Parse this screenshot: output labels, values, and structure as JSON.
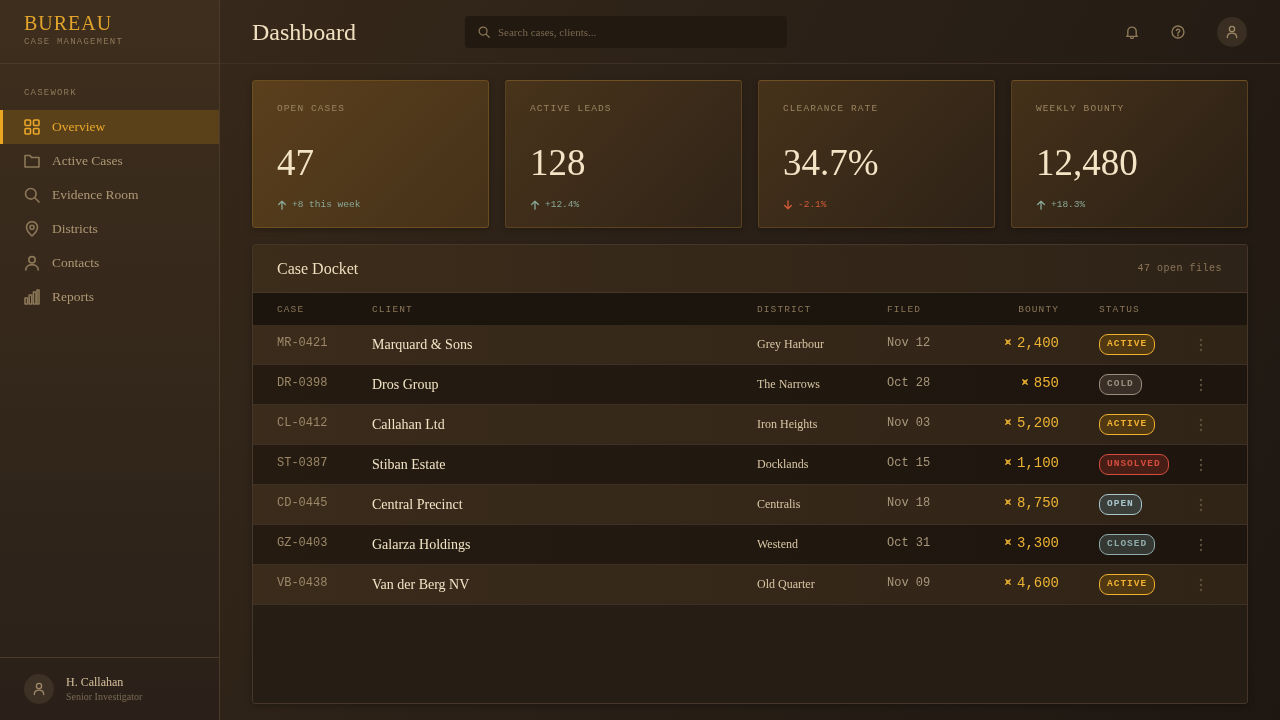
{
  "brand": {
    "title": "BUREAU",
    "subtitle": "CASE MANAGEMENT"
  },
  "sidebar": {
    "section": "CASEWORK",
    "items": [
      {
        "label": "Overview",
        "selected": true
      },
      {
        "label": "Active Cases",
        "selected": false
      },
      {
        "label": "Evidence Room",
        "selected": false
      },
      {
        "label": "Districts",
        "selected": false
      },
      {
        "label": "Contacts",
        "selected": false
      },
      {
        "label": "Reports",
        "selected": false
      }
    ],
    "user": {
      "name": "H. Callahan",
      "role": "Senior Investigator"
    }
  },
  "header": {
    "title": "Dashboard",
    "search": {
      "placeholder": "Search cases, clients..."
    }
  },
  "stats": [
    {
      "label": "OPEN CASES",
      "value": "47",
      "delta": "+8 this week",
      "kind": "up"
    },
    {
      "label": "ACTIVE LEADS",
      "value": "128",
      "delta": "+12.4%",
      "kind": "up"
    },
    {
      "label": "CLEARANCE RATE",
      "value": "34.7%",
      "delta": "-2.1%",
      "kind": "down"
    },
    {
      "label": "WEEKLY BOUNTY",
      "value": "12,480",
      "delta": "+18.3%",
      "kind": "up"
    }
  ],
  "docket": {
    "title": "Case Docket",
    "count": "47 open files",
    "columns": [
      "CASE",
      "CLIENT",
      "DISTRICT",
      "FILED",
      "BOUNTY",
      "STATUS"
    ],
    "rows": [
      {
        "case": "MR-0421",
        "client": "Marquard & Sons",
        "district": "Grey Harbour",
        "filed": "Nov 12",
        "bounty": "2,400",
        "status": {
          "label": "ACTIVE",
          "color": "#f0b030"
        }
      },
      {
        "case": "DR-0398",
        "client": "Dros Group",
        "district": "The Narrows",
        "filed": "Oct 28",
        "bounty": "850",
        "status": {
          "label": "COLD",
          "color": "#9c8e7e"
        }
      },
      {
        "case": "CL-0412",
        "client": "Callahan Ltd",
        "district": "Iron Heights",
        "filed": "Nov 03",
        "bounty": "5,200",
        "status": {
          "label": "ACTIVE",
          "color": "#f0b030"
        }
      },
      {
        "case": "ST-0387",
        "client": "Stiban Estate",
        "district": "Docklands",
        "filed": "Oct 15",
        "bounty": "1,100",
        "status": {
          "label": "UNSOLVED",
          "color": "#d44c3e"
        }
      },
      {
        "case": "CD-0445",
        "client": "Central Precinct",
        "district": "Centralis",
        "filed": "Nov 18",
        "bounty": "8,750",
        "status": {
          "label": "OPEN",
          "color": "#a8c6cc"
        }
      },
      {
        "case": "GZ-0403",
        "client": "Galarza Holdings",
        "district": "Westend",
        "filed": "Oct 31",
        "bounty": "3,300",
        "status": {
          "label": "CLOSED",
          "color": "#8eacac"
        }
      },
      {
        "case": "VB-0438",
        "client": "Van der Berg NV",
        "district": "Old Quarter",
        "filed": "Nov 09",
        "bounty": "4,600",
        "status": {
          "label": "ACTIVE",
          "color": "#f0b030"
        }
      }
    ]
  }
}
